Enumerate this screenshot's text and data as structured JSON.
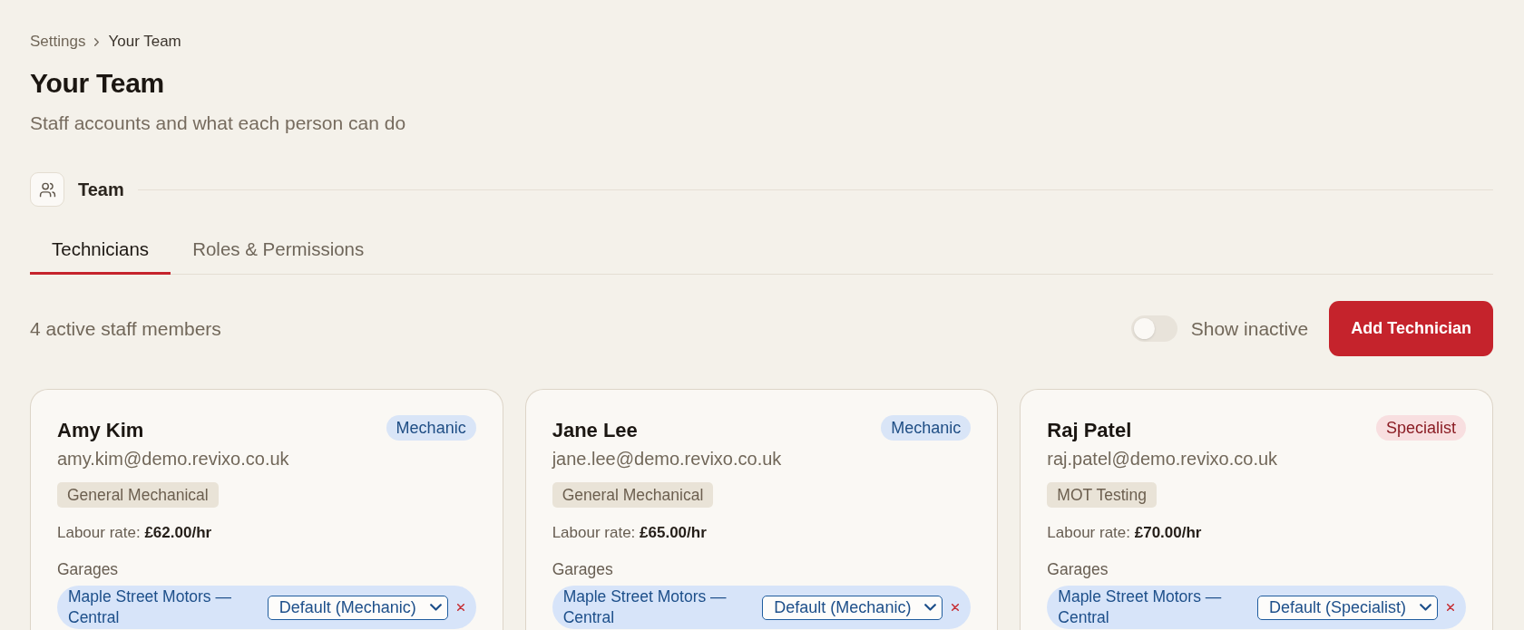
{
  "breadcrumb": [
    {
      "label": "Settings",
      "current": false
    },
    {
      "label": "Your Team",
      "current": true
    }
  ],
  "header": {
    "title": "Your Team",
    "subtitle": "Staff accounts and what each person can do"
  },
  "section": {
    "title": "Team"
  },
  "tabs": [
    {
      "label": "Technicians",
      "selected": true
    },
    {
      "label": "Roles & Permissions",
      "selected": false
    }
  ],
  "toolbar": {
    "count": "4 active staff members",
    "show_inactive": {
      "label": "Show inactive",
      "on": false
    },
    "add_button": "Add Technician"
  },
  "technicians": [
    {
      "name": "Amy Kim",
      "role": {
        "label": "Mechanic",
        "kind": "mechanic"
      },
      "email": "amy.kim@demo.revixo.co.uk",
      "specialty": "General Mechanical",
      "labour_rate": "Labour rate: **£62.00/hr**",
      "garages_label": "Garages",
      "garages": [
        {
          "name": "Maple Street Motors — Central",
          "role": "Default (Mechanic)"
        }
      ]
    },
    {
      "name": "Jane Lee",
      "role": {
        "label": "Mechanic",
        "kind": "mechanic"
      },
      "email": "jane.lee@demo.revixo.co.uk",
      "specialty": "General Mechanical",
      "labour_rate": "Labour rate: **£65.00/hr**",
      "garages_label": "Garages",
      "garages": [
        {
          "name": "Maple Street Motors — Central",
          "role": "Default (Mechanic)"
        }
      ]
    },
    {
      "name": "Raj Patel",
      "role": {
        "label": "Specialist",
        "kind": "specialist"
      },
      "email": "raj.patel@demo.revixo.co.uk",
      "specialty": "MOT Testing",
      "labour_rate": "Labour rate: **£70.00/hr**",
      "garages_label": "Garages",
      "garages": [
        {
          "name": "Maple Street Motors — Central",
          "role": "Default (Specialist)"
        }
      ]
    }
  ]
}
